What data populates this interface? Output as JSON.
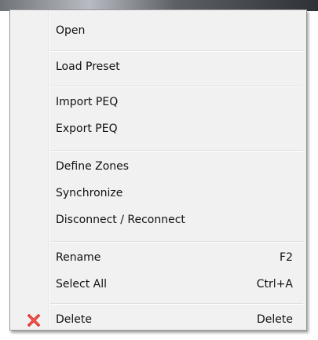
{
  "menu": {
    "items": [
      {
        "label": "Open",
        "shortcut": ""
      },
      {
        "label": "Load Preset",
        "shortcut": ""
      },
      {
        "label": "Import PEQ",
        "shortcut": ""
      },
      {
        "label": "Export PEQ",
        "shortcut": ""
      },
      {
        "label": "Define Zones",
        "shortcut": ""
      },
      {
        "label": "Synchronize",
        "shortcut": ""
      },
      {
        "label": "Disconnect / Reconnect",
        "shortcut": ""
      },
      {
        "label": "Rename",
        "shortcut": "F2"
      },
      {
        "label": "Select All",
        "shortcut": "Ctrl+A"
      },
      {
        "label": "Delete",
        "shortcut": "Delete",
        "icon": "red-x-delete-icon"
      }
    ]
  },
  "colors": {
    "menu_background": "#f1f1f1",
    "border": "#979797",
    "separator": "#e0e0e0",
    "delete_icon": "#e0302a"
  }
}
